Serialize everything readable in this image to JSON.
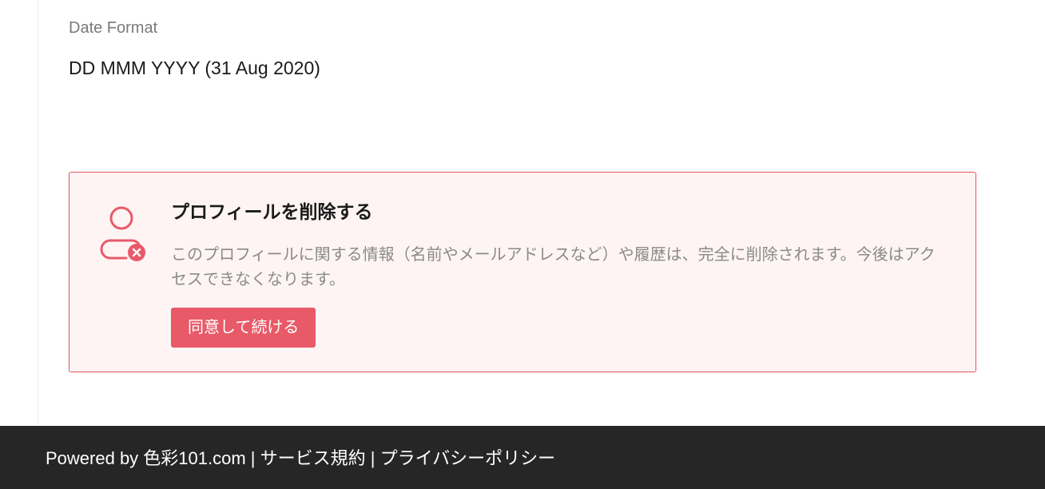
{
  "settings": {
    "date_format_label": "Date Format",
    "date_format_value": "DD MMM YYYY (31 Aug 2020)"
  },
  "delete_profile": {
    "icon": "user-remove-icon",
    "title": "プロフィールを削除する",
    "description": "このプロフィールに関する情報（名前やメールアドレスなど）や履歴は、完全に削除されます。今後はアクセスできなくなります。",
    "button_label": "同意して続ける",
    "accent_color": "#e85a68",
    "background_color": "#fff4f4"
  },
  "footer": {
    "powered_by": "Powered by 色彩101.com",
    "separator": "|",
    "terms_link": "サービス規約",
    "privacy_link": "プライバシーポリシー",
    "background_color": "#262626"
  }
}
